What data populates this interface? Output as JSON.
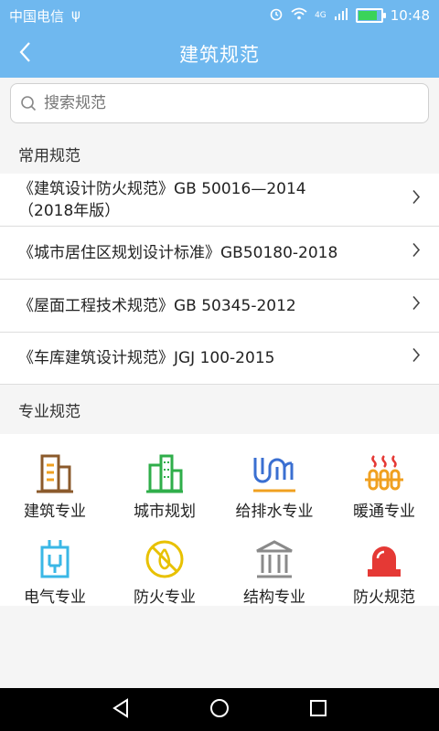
{
  "status": {
    "carrier": "中国电信",
    "time": "10:48",
    "network": "4G"
  },
  "header": {
    "title": "建筑规范"
  },
  "search": {
    "placeholder": "搜索规范"
  },
  "common": {
    "title": "常用规范",
    "items": [
      {
        "line1": "《建筑设计防火规范》GB 50016—2014",
        "line2": "（2018年版）"
      },
      {
        "line1": "《城市居住区规划设计标准》GB50180-2018",
        "line2": ""
      },
      {
        "line1": "《屋面工程技术规范》GB 50345-2012",
        "line2": ""
      },
      {
        "line1": "《车库建筑设计规范》JGJ 100-2015",
        "line2": ""
      }
    ]
  },
  "professional": {
    "title": "专业规范",
    "items": [
      {
        "label": "建筑专业",
        "icon": "building-icon",
        "color": "#8b5a2b"
      },
      {
        "label": "城市规划",
        "icon": "city-icon",
        "color": "#2fae4a"
      },
      {
        "label": "给排水专业",
        "icon": "water-pipe-icon",
        "color": "#3a6fd1"
      },
      {
        "label": "暖通专业",
        "icon": "heating-icon",
        "color": "#f0a020"
      },
      {
        "label": "电气专业",
        "icon": "electric-icon",
        "color": "#3ab7e6"
      },
      {
        "label": "防火专业",
        "icon": "no-fire-icon",
        "color": "#e8c100"
      },
      {
        "label": "结构专业",
        "icon": "structure-icon",
        "color": "#8a8a8a"
      },
      {
        "label": "防火规范",
        "icon": "alarm-icon",
        "color": "#e53935"
      }
    ]
  },
  "colors": {
    "header": "#6fb8ef",
    "background": "#f5f5f5"
  }
}
